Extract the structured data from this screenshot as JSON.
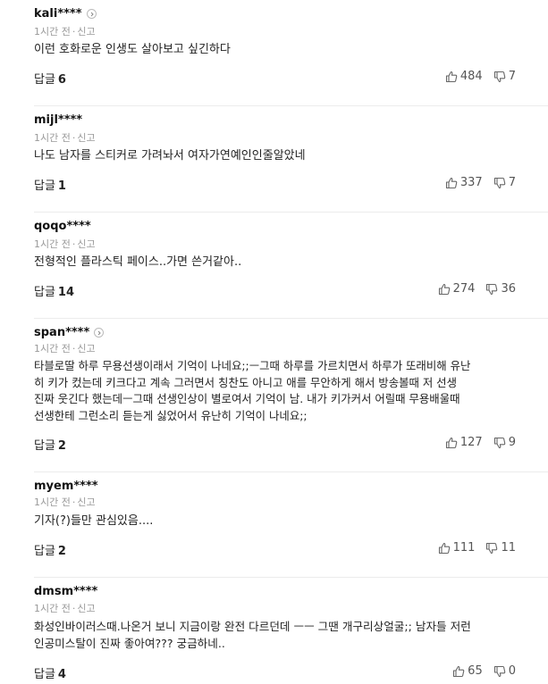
{
  "reply_label": "답글",
  "report_label": "신고",
  "dot": "·",
  "comments": [
    {
      "user": "kali****",
      "profile_icon": true,
      "time": "1시간 전",
      "text": "이런 호화로운 인생도 살아보고 싶긴하다",
      "replies": "6",
      "likes": "484",
      "dislikes": "7"
    },
    {
      "user": "mijl****",
      "profile_icon": false,
      "time": "1시간 전",
      "text": "나도 남자를 스티커로 가려놔서 여자가연예인인줄알았네",
      "replies": "1",
      "likes": "337",
      "dislikes": "7"
    },
    {
      "user": "qoqo****",
      "profile_icon": false,
      "time": "1시간 전",
      "text": "전형적인 플라스틱 페이스..가면 쓴거같아..",
      "replies": "14",
      "likes": "274",
      "dislikes": "36"
    },
    {
      "user": "span****",
      "profile_icon": true,
      "time": "1시간 전",
      "text": "타블로딸 하루 무용선생이래서 기억이 나네요;;ㅡ그때 하루를 가르치면서 하루가 또래비해 유난\n히 키가 컸는데 키크다고 계속 그러면서 칭찬도 아니고 애를 무안하게 해서 방송볼때 저 선생\n진짜 웃긴다 했는데ㅡ그때 선생인상이 별로여서 기억이 남. 내가 키가커서 어릴때 무용배울때\n선생한테 그런소리 듣는게 싫었어서 유난히 기억이 나네요;;",
      "replies": "2",
      "likes": "127",
      "dislikes": "9"
    },
    {
      "user": "myem****",
      "profile_icon": false,
      "time": "1시간 전",
      "text": "기자(?)들만 관심있음....",
      "replies": "2",
      "likes": "111",
      "dislikes": "11"
    },
    {
      "user": "dmsm****",
      "profile_icon": false,
      "time": "1시간 전",
      "text": "화성인바이러스때.나온거 보니 지금이랑 완전 다르던데 ㅡㅡ 그땐 개구리상얼굴;; 남자들 저런\n인공미스탈이 진짜 좋아여??? 궁금하네..",
      "replies": "4",
      "likes": "65",
      "dislikes": "0"
    }
  ]
}
